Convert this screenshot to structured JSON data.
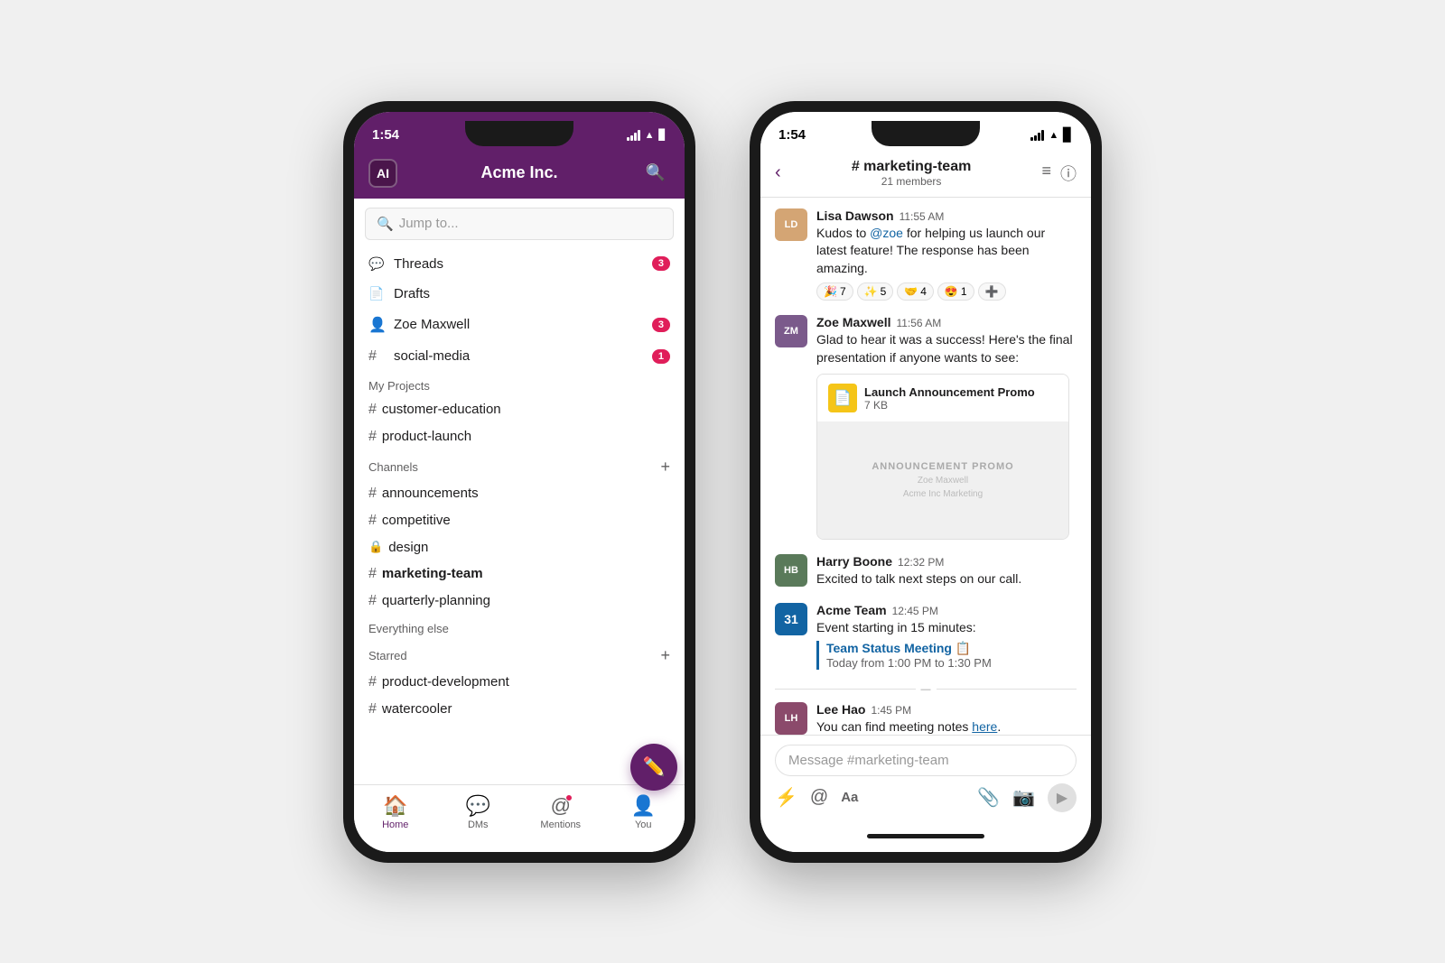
{
  "left_phone": {
    "status": {
      "time": "1:54",
      "signal": "●●●●",
      "wifi": "wifi",
      "battery": "battery"
    },
    "header": {
      "logo": "AI",
      "workspace": "Acme Inc.",
      "search_label": "search"
    },
    "search": {
      "placeholder": "Jump to..."
    },
    "quick_items": [
      {
        "icon": "threads",
        "label": "Threads",
        "badge": "3"
      },
      {
        "icon": "drafts",
        "label": "Drafts",
        "badge": ""
      }
    ],
    "direct_messages": [
      {
        "name": "Zoe Maxwell",
        "badge": "3",
        "online": true
      },
      {
        "name": "social-media",
        "badge": "1",
        "is_channel": true
      }
    ],
    "projects_label": "My Projects",
    "projects": [
      {
        "name": "customer-education"
      },
      {
        "name": "product-launch"
      }
    ],
    "channels_label": "Channels",
    "channels": [
      {
        "name": "announcements",
        "type": "public"
      },
      {
        "name": "competitive",
        "type": "public"
      },
      {
        "name": "design",
        "type": "private"
      },
      {
        "name": "marketing-team",
        "type": "public",
        "active": true
      },
      {
        "name": "quarterly-planning",
        "type": "public"
      }
    ],
    "everything_else_label": "Everything else",
    "starred_label": "Starred",
    "starred_channels": [
      {
        "name": "product-development"
      },
      {
        "name": "watercooler"
      }
    ],
    "nav": [
      {
        "icon": "home",
        "label": "Home",
        "active": true
      },
      {
        "icon": "dms",
        "label": "DMs",
        "dot": false
      },
      {
        "icon": "mentions",
        "label": "Mentions",
        "dot": true
      },
      {
        "icon": "you",
        "label": "You",
        "dot": false
      }
    ]
  },
  "right_phone": {
    "status": {
      "time": "1:54"
    },
    "header": {
      "channel": "# marketing-team",
      "members": "21 members",
      "back": "‹",
      "list_icon": "≡",
      "info_icon": "ⓘ"
    },
    "messages": [
      {
        "id": "msg1",
        "author": "Lisa Dawson",
        "time": "11:55 AM",
        "avatar_color": "#d4a574",
        "avatar_initials": "LD",
        "text": "Kudos to @zoe for helping us launch our latest feature! The response has been amazing.",
        "has_mention": true,
        "mention_text": "@zoe",
        "reactions": [
          {
            "emoji": "🎉",
            "count": "7"
          },
          {
            "emoji": "✨",
            "count": "5"
          },
          {
            "emoji": "🤝",
            "count": "4"
          },
          {
            "emoji": "😍",
            "count": "1"
          },
          {
            "emoji": "➕",
            "count": ""
          }
        ]
      },
      {
        "id": "msg2",
        "author": "Zoe Maxwell",
        "time": "11:56 AM",
        "avatar_color": "#7b5a8b",
        "avatar_initials": "ZM",
        "text": "Glad to hear it was a success! Here's the final presentation if anyone wants to see:",
        "file": {
          "name": "Launch Announcement Promo",
          "size": "7 KB",
          "preview_text": "ANNOUNCEMENT PROMO",
          "preview_sub1": "Zoe Maxwell",
          "preview_sub2": "Acme Inc Marketing"
        }
      },
      {
        "id": "msg3",
        "author": "Harry Boone",
        "time": "12:32 PM",
        "avatar_color": "#5a7a5a",
        "avatar_initials": "HB",
        "text": "Excited to talk next steps on our call."
      },
      {
        "id": "msg4",
        "author": "Acme Team",
        "time": "12:45 PM",
        "avatar_type": "calendar",
        "avatar_text": "31",
        "text": "Event starting in 15 minutes:",
        "event": {
          "title": "Team Status Meeting 📋",
          "time": "Today from 1:00 PM to 1:30 PM"
        }
      },
      {
        "id": "msg5",
        "author": "Lee Hao",
        "time": "1:45 PM",
        "avatar_color": "#8b4a6b",
        "avatar_initials": "LH",
        "text_before": "You can find meeting notes ",
        "link_text": "here",
        "text_after": "."
      }
    ],
    "input": {
      "placeholder": "Message #marketing-team"
    },
    "input_actions": [
      {
        "icon": "⚡",
        "name": "shortcuts"
      },
      {
        "icon": "@",
        "name": "mention"
      },
      {
        "icon": "Aa",
        "name": "format"
      },
      {
        "icon": "📎",
        "name": "attach"
      },
      {
        "icon": "📷",
        "name": "camera"
      }
    ],
    "divider_text": "—"
  }
}
